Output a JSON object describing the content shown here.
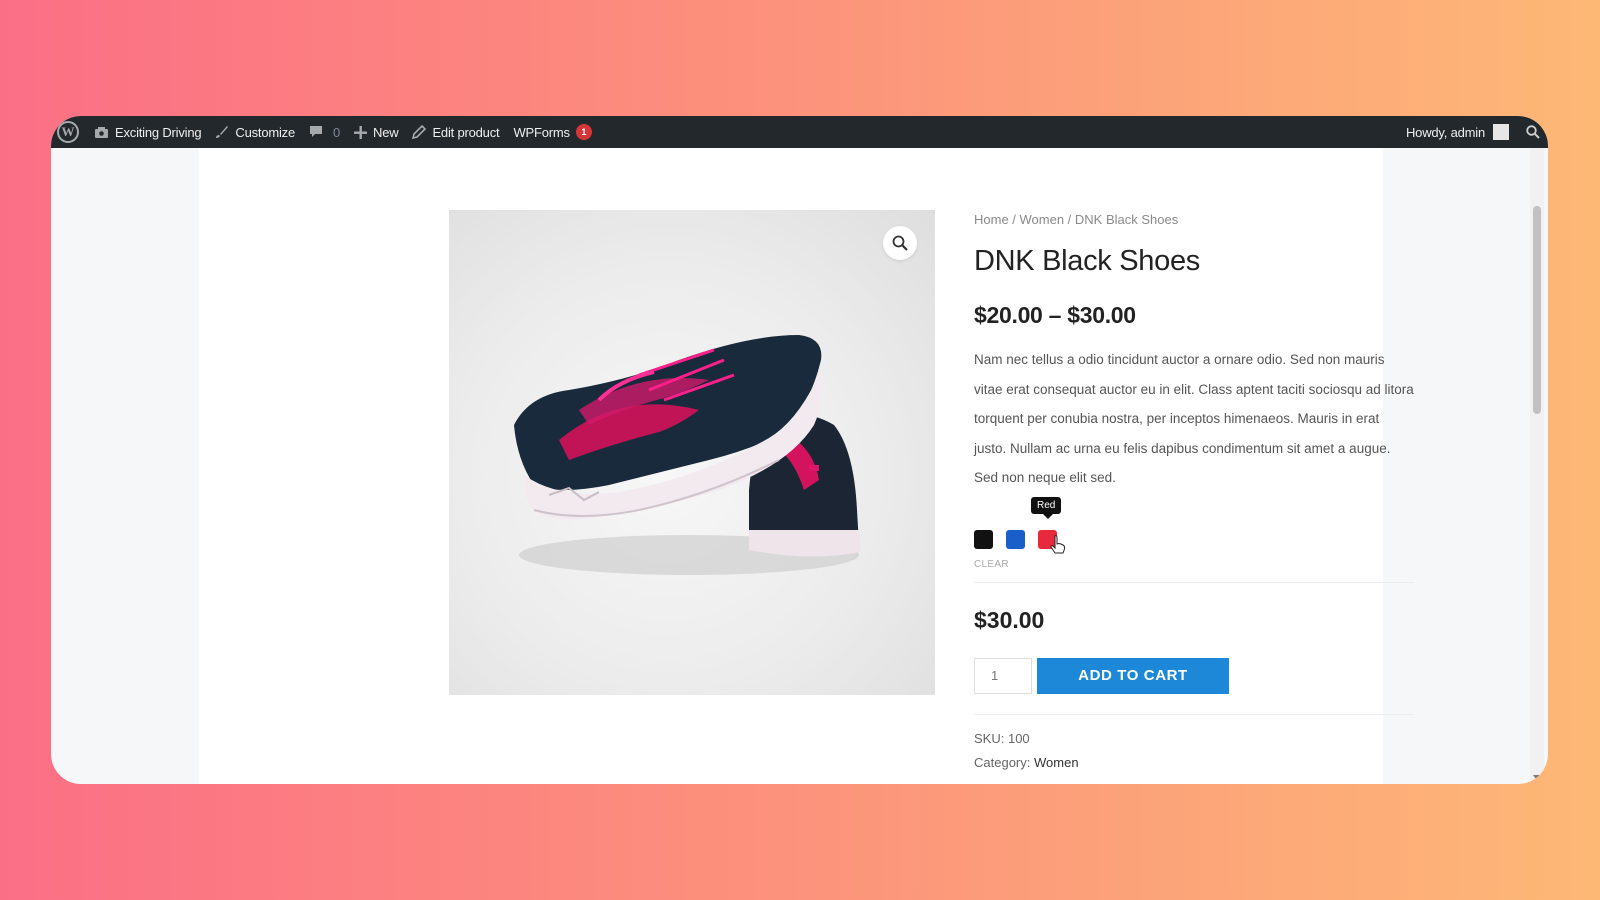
{
  "admin_bar": {
    "site_name": "Exciting Driving",
    "customize": "Customize",
    "comments_count": "0",
    "new": "New",
    "edit_product": "Edit product",
    "wpforms": "WPForms",
    "wpforms_badge": "1",
    "greeting": "Howdy, admin"
  },
  "breadcrumb": "Home / Women / DNK Black Shoes",
  "product": {
    "title": "DNK Black Shoes",
    "price_range": "$20.00 – $30.00",
    "description": "Nam nec tellus a odio tincidunt auctor a ornare odio. Sed non mauris vitae erat consequat auctor eu in elit. Class aptent taciti sociosqu ad litora torquent per conubia nostra, per inceptos himenaeos. Mauris in erat justo. Nullam ac urna eu felis dapibus condimentum sit amet a augue. Sed non neque elit sed.",
    "swatches": [
      {
        "name": "Black",
        "color": "#111111"
      },
      {
        "name": "Blue",
        "color": "#1a5fc9"
      },
      {
        "name": "Red",
        "color": "#e8283c"
      }
    ],
    "tooltip": "Red",
    "clear_label": "CLEAR",
    "price": "$30.00",
    "quantity": "1",
    "add_to_cart": "ADD TO CART",
    "sku_label": "SKU:",
    "sku": "100",
    "category_label": "Category:",
    "category": "Women"
  },
  "colors": {
    "admin_bar": "#23282d",
    "button": "#1e88d8"
  }
}
